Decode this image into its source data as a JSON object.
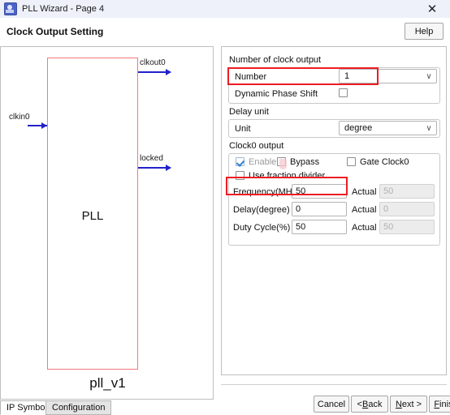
{
  "window": {
    "title": "PLL Wizard - Page 4",
    "app_icon": "pll-app-icon",
    "close_label": "✕"
  },
  "header": {
    "page_title": "Clock Output Setting",
    "help_label": "Help"
  },
  "symbol": {
    "module_name": "pll_v1",
    "block_label": "PLL",
    "block_border_color": "#f4797c",
    "wire_color": "#2222cc",
    "ports": [
      {
        "name": "clkin0",
        "direction": "input"
      },
      {
        "name": "clkout0",
        "direction": "output"
      },
      {
        "name": "locked",
        "direction": "output"
      }
    ]
  },
  "config": {
    "number_group": {
      "caption": "Number of clock output",
      "number_label": "Number",
      "number_value": "1",
      "number_chevron": "∨",
      "dynamic_phase_shift_label": "Dynamic Phase Shift",
      "dynamic_phase_shift_checked": false
    },
    "delay_unit_group": {
      "caption": "Delay unit",
      "unit_label": "Unit",
      "unit_value": "degree",
      "unit_chevron": "∨"
    },
    "clock0_group": {
      "caption": "Clock0 output",
      "enable_label": "Enable",
      "enable_checked": true,
      "enable_disabled": true,
      "bypass_label": "Bypass",
      "bypass_checked": false,
      "gate_clock0_label": "Gate Clock0",
      "gate_clock0_checked": false,
      "use_fraction_divider_label": "Use fraction divider",
      "use_fraction_divider_checked": false,
      "rows": [
        {
          "label": "Frequency(MHz)",
          "value": "50",
          "actual_label": "Actual",
          "actual_value": "50"
        },
        {
          "label": "Delay(degree)",
          "value": "0",
          "actual_label": "Actual",
          "actual_value": "0"
        },
        {
          "label": "Duty Cycle(%)",
          "value": "50",
          "actual_label": "Actual",
          "actual_value": "50"
        }
      ]
    },
    "highlight_color": "#ee1c23"
  },
  "footer": {
    "cancel": "Cancel",
    "back_prefix": "< ",
    "back_mnemonic": "B",
    "back_suffix": "ack",
    "next_prefix": "",
    "next_mnemonic": "N",
    "next_suffix": "ext >",
    "finish_mnemonic": "F",
    "finish_suffix": "inish"
  },
  "tabs": [
    {
      "label": "IP Symbol",
      "selected": true
    },
    {
      "label": "Configuration",
      "selected": false
    }
  ]
}
